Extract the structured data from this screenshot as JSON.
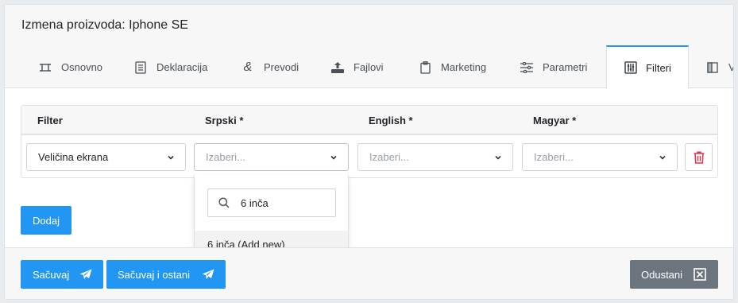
{
  "header": {
    "title": "Izmena proizvoda: Iphone SE"
  },
  "tabs": [
    {
      "label": "Osnovno",
      "icon": "crop-frame-icon"
    },
    {
      "label": "Deklaracija",
      "icon": "document-list-icon"
    },
    {
      "label": "Prevodi",
      "icon": "ampersand-icon"
    },
    {
      "label": "Fajlovi",
      "icon": "upload-tray-icon"
    },
    {
      "label": "Marketing",
      "icon": "clipboard-icon"
    },
    {
      "label": "Parametri",
      "icon": "sliders-icon"
    },
    {
      "label": "Filteri",
      "icon": "filter-sliders-icon",
      "active": true
    },
    {
      "label": "V",
      "icon": "columns-icon"
    }
  ],
  "table": {
    "columns": [
      "Filter",
      "Srpski *",
      "English *",
      "Magyar *"
    ],
    "row": {
      "filter_value": "Veličina ekrana",
      "srpski_placeholder": "Izaberi...",
      "english_placeholder": "Izaberi...",
      "magyar_placeholder": "Izaberi..."
    }
  },
  "dropdown": {
    "search_value": "6 inča",
    "option": "6 inča (Add new)"
  },
  "buttons": {
    "add": "Dodaj",
    "save": "Sačuvaj",
    "save_stay": "Sačuvaj i ostani",
    "cancel": "Odustani"
  },
  "colors": {
    "primary": "#2196f3",
    "secondary": "#6c757d",
    "danger": "#dc3545"
  }
}
